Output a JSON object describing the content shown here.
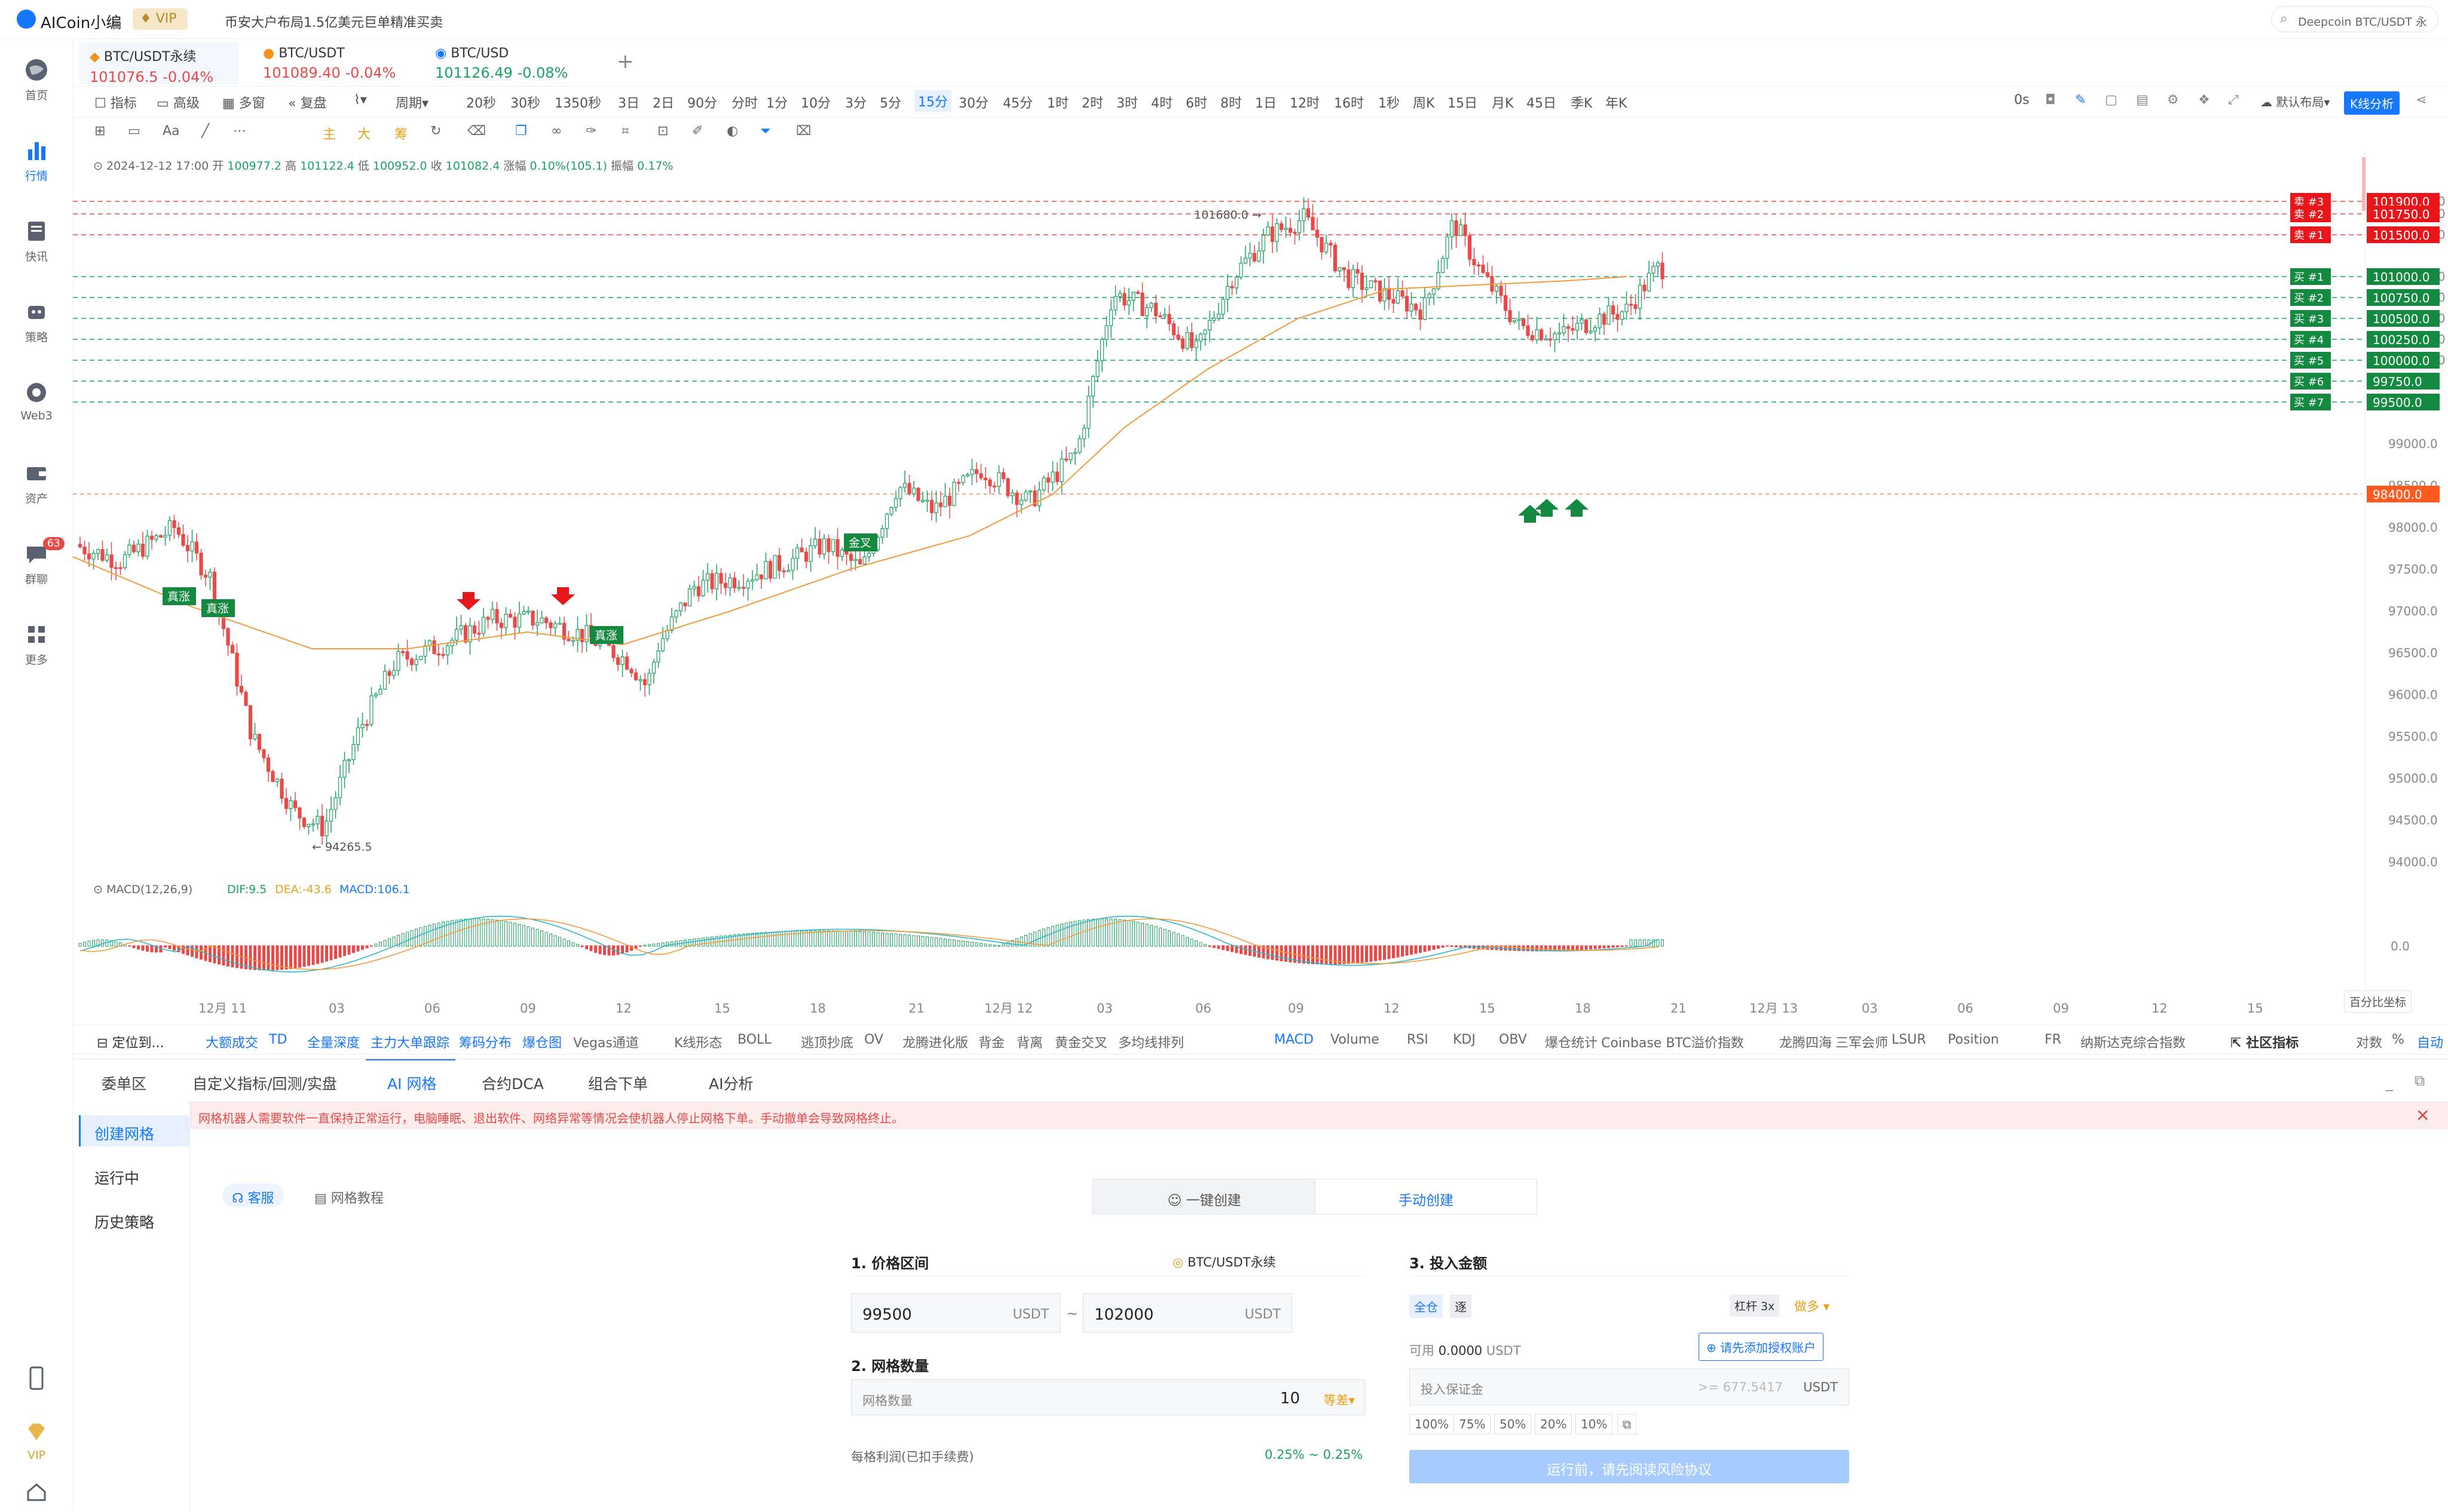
{
  "topbar": {
    "logo_text": "AICoin小编",
    "vip_badge": "VIP",
    "headline": "币安大户布局1.5亿美元巨单精准买卖",
    "search_placeholder": "Deepcoin BTC/USDT 永"
  },
  "sidebar": {
    "items": [
      {
        "label": "首页",
        "icon": "globe-icon"
      },
      {
        "label": "行情",
        "icon": "bar-chart-icon",
        "active": true
      },
      {
        "label": "快讯",
        "icon": "news-icon"
      },
      {
        "label": "策略",
        "icon": "robot-icon"
      },
      {
        "label": "Web3",
        "icon": "web3-icon"
      },
      {
        "label": "资产",
        "icon": "wallet-icon"
      },
      {
        "label": "群聊",
        "icon": "chat-icon",
        "badge": "63"
      },
      {
        "label": "更多",
        "icon": "grid-icon"
      }
    ],
    "bottom_vip": "VIP"
  },
  "pair_tabs": [
    {
      "name": "BTC/USDT永续",
      "price": "101076.5",
      "change": "-0.04%",
      "active": true
    },
    {
      "name": "BTC/USDT",
      "price": "101089.40",
      "change": "-0.04%"
    },
    {
      "name": "BTC/USD",
      "price": "101126.49",
      "change": "-0.08%"
    }
  ],
  "add_tab": "+",
  "toolbar": {
    "left": [
      "指标",
      "高级",
      "多窗",
      "复盘",
      "周期"
    ],
    "periods": [
      "20秒",
      "30秒",
      "1350秒",
      "3日",
      "2日",
      "90分",
      "分时",
      "1分",
      "10分",
      "3分",
      "5分",
      "15分",
      "30分",
      "45分",
      "1时",
      "2时",
      "3时",
      "4时",
      "6时",
      "8时",
      "1日",
      "12时",
      "16时",
      "1秒",
      "周K",
      "15日",
      "月K",
      "45日",
      "季K",
      "年K"
    ],
    "active_period": "15分",
    "right_zero": "0s",
    "layout": "默认布局",
    "kline_btn": "K线分析"
  },
  "draw_tools": [
    "主",
    "大",
    "筹"
  ],
  "ohlc": {
    "time": "2024-12-12 17:00",
    "open_label": "开",
    "open": "100977.2",
    "high_label": "高",
    "high": "101122.4",
    "low_label": "低",
    "low": "100952.0",
    "close_label": "收",
    "close": "101082.4",
    "change_label": "涨幅",
    "change": "0.10%(105.1)",
    "amp_label": "振幅",
    "amp": "0.17%"
  },
  "chart_data": {
    "type": "candlestick",
    "price_axis": [
      "101900.0",
      "101750.0",
      "101500.0",
      "101000.0",
      "100750.0",
      "100500.0",
      "100250.0",
      "100000.0",
      "99750.0",
      "99500.0",
      "99000.0",
      "98500.0",
      "98400.0",
      "98000.0",
      "97500.0",
      "97000.0",
      "96500.0",
      "96000.0",
      "95500.0",
      "95000.0",
      "94500.0",
      "94000.0"
    ],
    "time_axis": [
      "12月 11",
      "03",
      "06",
      "09",
      "12",
      "15",
      "18",
      "21",
      "12月 12",
      "03",
      "06",
      "09",
      "12",
      "15",
      "18",
      "21",
      "12月 13",
      "03",
      "06",
      "09",
      "12",
      "15"
    ],
    "high_marker": "101680.0",
    "low_marker": "94265.5",
    "sell_levels": [
      {
        "label": "卖 #3",
        "price": "101900.0"
      },
      {
        "label": "卖 #2",
        "price": "101750.0"
      },
      {
        "label": "卖 #1",
        "price": "101500.0"
      }
    ],
    "buy_levels": [
      {
        "label": "买 #1",
        "price": "101000.0"
      },
      {
        "label": "买 #2",
        "price": "100750.0"
      },
      {
        "label": "买 #3",
        "price": "100500.0"
      },
      {
        "label": "买 #4",
        "price": "100250.0"
      },
      {
        "label": "买 #5",
        "price": "100000.0"
      },
      {
        "label": "买 #6",
        "price": "99750.0"
      },
      {
        "label": "买 #7",
        "price": "99500.0"
      }
    ],
    "current_line": "98400.0",
    "signals": [
      {
        "label": "真涨"
      },
      {
        "label": "真涨"
      },
      {
        "label": "真涨"
      },
      {
        "label": "金叉"
      }
    ],
    "macd": {
      "label": "MACD(12,26,9)",
      "dif": "DIF:9.5",
      "dea": "DEA:-43.6",
      "macd": "MACD:106.1",
      "zero": "0.0"
    }
  },
  "percent_coord": "百分比坐标",
  "indicators": {
    "locate": "定位到...",
    "left": [
      "大额成交",
      "TD",
      "全量深度",
      "主力大单跟踪",
      "筹码分布",
      "爆仓图",
      "Vegas通道",
      "K线形态",
      "BOLL",
      "逃顶抄底",
      "OV",
      "龙腾进化版",
      "背金",
      "背离",
      "黄金交叉",
      "多均线排列"
    ],
    "right": [
      "MACD",
      "Volume",
      "RSI",
      "KDJ",
      "OBV",
      "爆仓统计",
      "Coinbase BTC溢价指数",
      "龙腾四海",
      "三军会师",
      "LSUR",
      "Position",
      "FR",
      "纳斯达克综合指数"
    ],
    "community": "社区指标",
    "log": "对数",
    "pct": "%",
    "auto": "自动"
  },
  "bottom": {
    "tabs": [
      "委单区",
      "自定义指标/回测/实盘",
      "AI 网格",
      "合约DCA",
      "组合下单",
      "AI分析"
    ],
    "active_tab": "AI 网格",
    "menu": [
      "创建网格",
      "运行中",
      "历史策略"
    ],
    "warning": "网格机器人需要软件一直保持正常运行，电脑睡眠、退出软件、网络异常等情况会使机器人停止网格下单。手动撤单会导致网格终止。",
    "service": "客服",
    "tutorial": "网格教程",
    "mode_auto": "一键创建",
    "mode_manual": "手动创建",
    "section1": "1. 价格区间",
    "pair": "BTC/USDT永续",
    "price_low": "99500",
    "price_high": "102000",
    "unit": "USDT",
    "section2": "2. 网格数量",
    "grid_label": "网格数量",
    "grid_count": "10",
    "grid_type": "等差",
    "profit_label": "每格利润(已扣手续费)",
    "profit_value": "0.25% ~ 0.25%",
    "section3": "3. 投入金额",
    "mode_cross": "全仓",
    "mode_isolated": "逐",
    "leverage": "杠杆 3x",
    "direction": "做多",
    "available_label": "可用",
    "available": "0.0000",
    "auth_btn": "请先添加授权账户",
    "margin_label": "投入保证金",
    "margin_placeholder": ">= 677.5417",
    "pcts": [
      "100%",
      "75%",
      "50%",
      "20%",
      "10%"
    ],
    "submit": "运行前，请先阅读风险协议"
  }
}
